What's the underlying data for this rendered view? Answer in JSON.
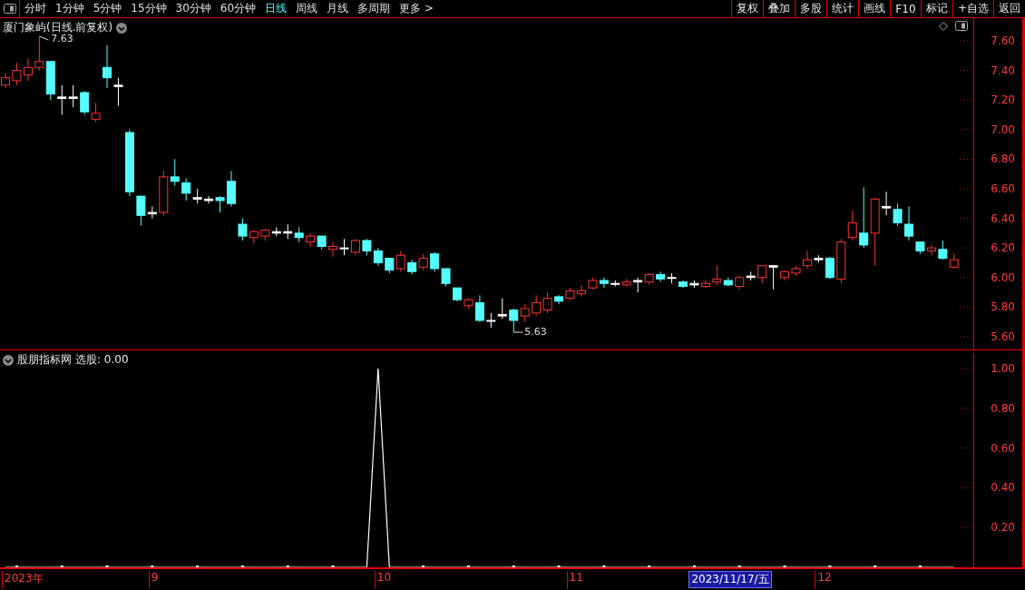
{
  "toolbar": {
    "periods": [
      {
        "label": "分时",
        "selected": false
      },
      {
        "label": "1分钟",
        "selected": false
      },
      {
        "label": "5分钟",
        "selected": false
      },
      {
        "label": "15分钟",
        "selected": false
      },
      {
        "label": "30分钟",
        "selected": false
      },
      {
        "label": "60分钟",
        "selected": false
      },
      {
        "label": "日线",
        "selected": true
      },
      {
        "label": "周线",
        "selected": false
      },
      {
        "label": "月线",
        "selected": false
      },
      {
        "label": "多周期",
        "selected": false
      },
      {
        "label": "更多 >",
        "selected": false
      }
    ],
    "actions": [
      "复权",
      "叠加",
      "多股",
      "统计",
      "画线",
      "F10",
      "标记",
      "+自选",
      "返回"
    ]
  },
  "price_pane": {
    "title": "厦门象屿(日线.前复权)",
    "high_label": "7.63",
    "low_label": "5.63",
    "axis_labels": [
      "7.60",
      "7.40",
      "7.20",
      "7.00",
      "6.80",
      "6.60",
      "6.40",
      "6.20",
      "6.00",
      "5.80",
      "5.60"
    ]
  },
  "indicator_pane": {
    "name": "股朋指标网",
    "reading": "选股: 0.00",
    "chart_data": {
      "type": "line",
      "ylim": [
        0,
        1
      ],
      "yticks": [
        {
          "value": 0.2,
          "label": "0.20"
        },
        {
          "value": 0.4,
          "label": "0.40"
        },
        {
          "value": 0.6,
          "label": "0.60"
        },
        {
          "value": 0.8,
          "label": "0.80"
        },
        {
          "value": 1,
          "label": "1.00"
        }
      ],
      "series": [
        {
          "color": "#ffffff",
          "values": [
            0,
            0,
            0,
            0,
            0,
            0,
            0,
            0,
            0,
            0,
            0,
            0,
            0,
            0,
            0,
            0,
            0,
            0,
            0,
            0,
            0,
            0,
            0,
            0,
            0,
            0,
            0,
            0,
            0,
            0,
            0,
            0,
            0,
            1,
            0,
            0,
            0,
            0,
            0,
            0,
            0,
            0,
            0,
            0,
            0,
            0,
            0,
            0,
            0,
            0,
            0,
            0,
            0,
            0,
            0,
            0,
            0,
            0,
            0,
            0,
            0,
            0,
            0,
            0,
            0,
            0,
            0,
            0,
            0,
            0,
            0,
            0,
            0,
            0,
            0,
            0,
            0,
            0,
            0,
            0,
            0,
            0,
            0,
            0,
            0
          ]
        }
      ]
    }
  },
  "date_axis": [
    "2023年",
    "9",
    "10",
    "11",
    "12"
  ],
  "cursor_date": "2023/11/17/五"
}
